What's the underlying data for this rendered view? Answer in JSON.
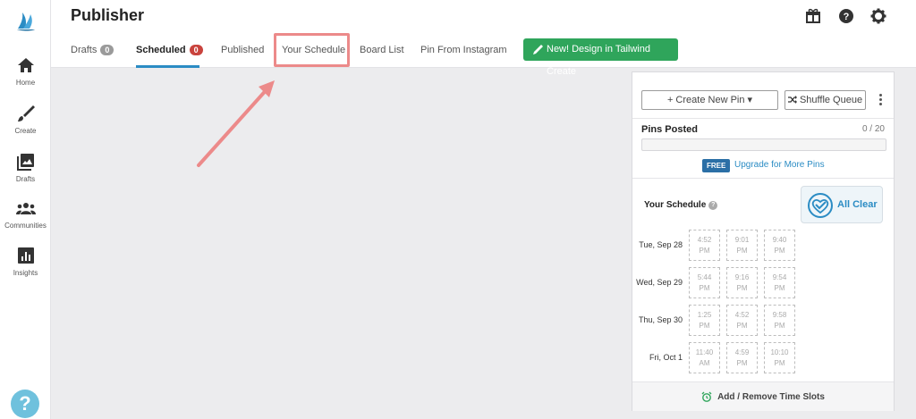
{
  "header": {
    "title": "Publisher"
  },
  "sidebar": {
    "items": [
      {
        "label": "Home",
        "icon": "home-icon"
      },
      {
        "label": "Create",
        "icon": "brush-icon"
      },
      {
        "label": "Drafts",
        "icon": "drafts-icon"
      },
      {
        "label": "Communities",
        "icon": "communities-icon"
      },
      {
        "label": "Insights",
        "icon": "insights-icon"
      }
    ],
    "help": "?"
  },
  "tabs": [
    {
      "label": "Drafts",
      "badge": "0"
    },
    {
      "label": "Scheduled",
      "badge": "0"
    },
    {
      "label": "Published"
    },
    {
      "label": "Your Schedule"
    },
    {
      "label": "Board List"
    },
    {
      "label": "Pin From Instagram"
    }
  ],
  "design_button": "New! Design in Tailwind Create",
  "panel": {
    "create_pin": "+ Create New Pin ▾",
    "shuffle": "Shuffle Queue",
    "pins_posted_label": "Pins Posted",
    "pins_posted_count": "0 / 20",
    "pins_posted_progress": 0,
    "free_badge": "FREE",
    "upgrade_link": "Upgrade for More Pins",
    "schedule_title": "Your Schedule",
    "schedule_help": "?",
    "all_clear": "All Clear",
    "days": [
      {
        "label": "Tue, Sep 28",
        "slots": [
          [
            "4:52",
            "PM"
          ],
          [
            "9:01",
            "PM"
          ],
          [
            "9:40",
            "PM"
          ]
        ]
      },
      {
        "label": "Wed, Sep 29",
        "slots": [
          [
            "5:44",
            "PM"
          ],
          [
            "9:16",
            "PM"
          ],
          [
            "9:54",
            "PM"
          ]
        ]
      },
      {
        "label": "Thu, Sep 30",
        "slots": [
          [
            "1:25",
            "PM"
          ],
          [
            "4:52",
            "PM"
          ],
          [
            "9:58",
            "PM"
          ]
        ]
      },
      {
        "label": "Fri, Oct 1",
        "slots": [
          [
            "11:40",
            "AM"
          ],
          [
            "4:59",
            "PM"
          ],
          [
            "10:10",
            "PM"
          ]
        ]
      }
    ],
    "add_remove": "Add / Remove Time Slots"
  },
  "colors": {
    "accent": "#2b8cc4",
    "green": "#2fa55b",
    "highlight": "#ec8a8a",
    "badge_red": "#c9433d"
  }
}
